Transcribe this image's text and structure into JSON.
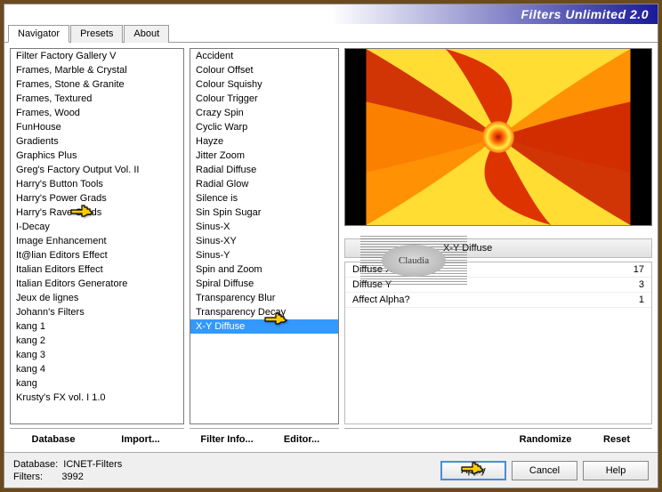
{
  "header": {
    "title": "Filters Unlimited 2.0"
  },
  "tabs": [
    "Navigator",
    "Presets",
    "About"
  ],
  "activeTab": 0,
  "leftList": [
    "Filter Factory Gallery V",
    "Frames, Marble & Crystal",
    "Frames, Stone & Granite",
    "Frames, Textured",
    "Frames, Wood",
    "FunHouse",
    "Gradients",
    "Graphics Plus",
    "Greg's Factory Output Vol. II",
    "Harry's Button Tools",
    "Harry's Power Grads",
    "Harry's Rave Grads",
    "I-Decay",
    "Image Enhancement",
    "It@lian Editors Effect",
    "Italian Editors Effect",
    "Italian Editors Generatore",
    "Jeux de lignes",
    "Johann's Filters",
    "kang 1",
    "kang 2",
    "kang 3",
    "kang 4",
    "kang",
    "Krusty's FX vol. I 1.0"
  ],
  "leftSelectedIndex": 12,
  "midList": [
    "Accident",
    "Colour Offset",
    "Colour Squishy",
    "Colour Trigger",
    "Crazy Spin",
    "Cyclic Warp",
    "Hayze",
    "Jitter Zoom",
    "Radial Diffuse",
    "Radial Glow",
    "Silence is",
    "Sin Spin Sugar",
    "Sinus-X",
    "Sinus-XY",
    "Sinus-Y",
    "Spin and Zoom",
    "Spiral Diffuse",
    "Transparency Blur",
    "Transparency Decay",
    "X-Y Diffuse"
  ],
  "midSelectedIndex": 19,
  "leftButtons": {
    "database": "Database",
    "import": "Import..."
  },
  "midButtons": {
    "filterInfo": "Filter Info...",
    "editor": "Editor..."
  },
  "filterName": "X-Y Diffuse",
  "params": [
    {
      "name": "Diffuse X",
      "value": "17"
    },
    {
      "name": "Diffuse Y",
      "value": "3"
    },
    {
      "name": "Affect Alpha?",
      "value": "1"
    }
  ],
  "rightButtons": {
    "randomize": "Randomize",
    "reset": "Reset"
  },
  "footer": {
    "dbLabel": "Database:",
    "dbValue": "ICNET-Filters",
    "filtersLabel": "Filters:",
    "filtersValue": "3992",
    "apply": "Apply",
    "cancel": "Cancel",
    "help": "Help"
  },
  "watermark": "Claudia"
}
